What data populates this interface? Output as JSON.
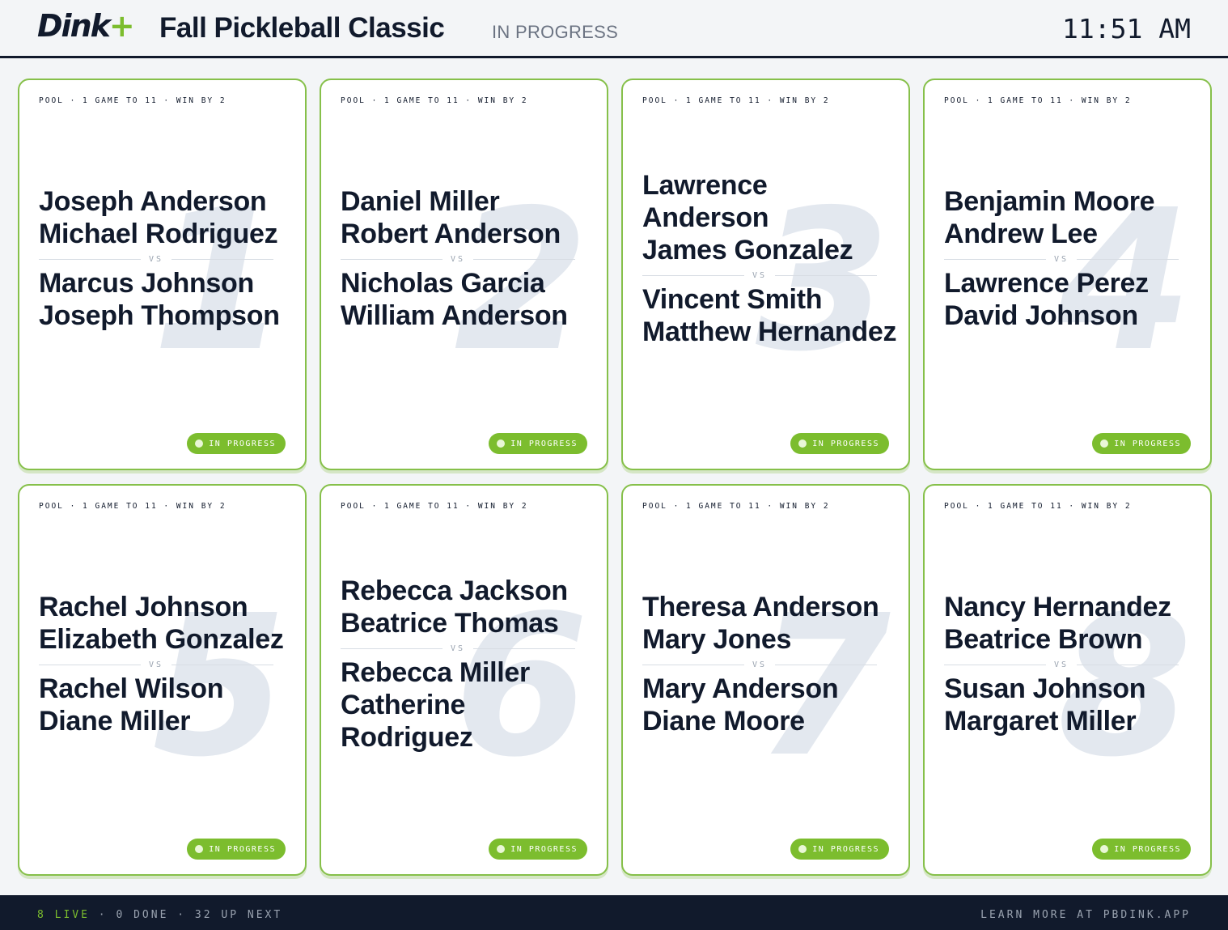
{
  "header": {
    "logo_text": "Dink",
    "logo_plus": "+",
    "event_title": "Fall Pickleball Classic",
    "event_status": "IN PROGRESS",
    "clock": "11:51 AM"
  },
  "colors": {
    "accent": "#7cbd2e",
    "ink": "#111a2c",
    "card_border": "#86c04a",
    "big_number": "#e3e8ef",
    "muted": "#6b7382"
  },
  "matches": [
    {
      "court": "1",
      "format": "POOL · 1 GAME TO 11 · WIN BY 2",
      "team_a": [
        "Joseph Anderson",
        "Michael Rodriguez"
      ],
      "vs": "VS",
      "team_b": [
        "Marcus Johnson",
        "Joseph Thompson"
      ],
      "status": "IN PROGRESS"
    },
    {
      "court": "2",
      "format": "POOL · 1 GAME TO 11 · WIN BY 2",
      "team_a": [
        "Daniel Miller",
        "Robert Anderson"
      ],
      "vs": "VS",
      "team_b": [
        "Nicholas Garcia",
        "William Anderson"
      ],
      "status": "IN PROGRESS"
    },
    {
      "court": "3",
      "format": "POOL · 1 GAME TO 11 · WIN BY 2",
      "team_a": [
        "Lawrence Anderson",
        "James Gonzalez"
      ],
      "vs": "VS",
      "team_b": [
        "Vincent Smith",
        "Matthew Hernandez"
      ],
      "status": "IN PROGRESS"
    },
    {
      "court": "4",
      "format": "POOL · 1 GAME TO 11 · WIN BY 2",
      "team_a": [
        "Benjamin Moore",
        "Andrew Lee"
      ],
      "vs": "VS",
      "team_b": [
        "Lawrence Perez",
        "David Johnson"
      ],
      "status": "IN PROGRESS"
    },
    {
      "court": "5",
      "format": "POOL · 1 GAME TO 11 · WIN BY 2",
      "team_a": [
        "Rachel Johnson",
        "Elizabeth Gonzalez"
      ],
      "vs": "VS",
      "team_b": [
        "Rachel Wilson",
        "Diane Miller"
      ],
      "status": "IN PROGRESS"
    },
    {
      "court": "6",
      "format": "POOL · 1 GAME TO 11 · WIN BY 2",
      "team_a": [
        "Rebecca Jackson",
        "Beatrice Thomas"
      ],
      "vs": "VS",
      "team_b": [
        "Rebecca Miller",
        "Catherine Rodriguez"
      ],
      "status": "IN PROGRESS"
    },
    {
      "court": "7",
      "format": "POOL · 1 GAME TO 11 · WIN BY 2",
      "team_a": [
        "Theresa Anderson",
        "Mary Jones"
      ],
      "vs": "VS",
      "team_b": [
        "Mary Anderson",
        "Diane Moore"
      ],
      "status": "IN PROGRESS"
    },
    {
      "court": "8",
      "format": "POOL · 1 GAME TO 11 · WIN BY 2",
      "team_a": [
        "Nancy Hernandez",
        "Beatrice Brown"
      ],
      "vs": "VS",
      "team_b": [
        "Susan Johnson",
        "Margaret Miller"
      ],
      "status": "IN PROGRESS"
    }
  ],
  "footer": {
    "live": "8 LIVE",
    "sep": " · ",
    "done": "0 DONE",
    "up_next": "32 UP NEXT",
    "learn_more": "LEARN MORE AT PBDINK.APP"
  }
}
